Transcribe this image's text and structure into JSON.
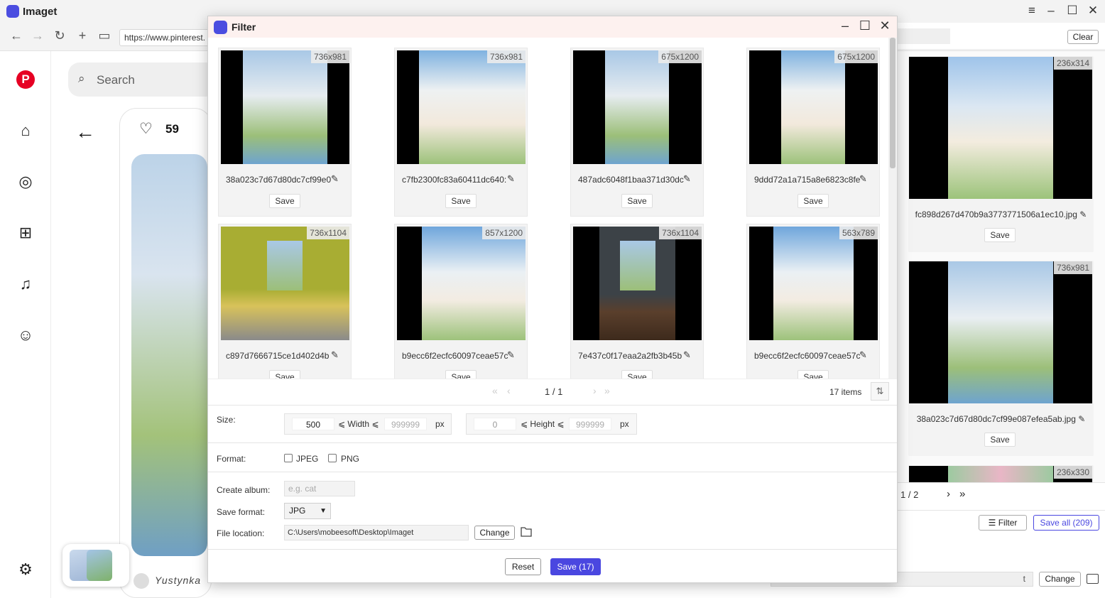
{
  "app": {
    "title": "Imaget"
  },
  "browser": {
    "url": "https://www.pinterest."
  },
  "pinterest": {
    "search_placeholder": "Search",
    "likes": "59",
    "author": "Yustynka"
  },
  "filter_dialog": {
    "title": "Filter",
    "cards": [
      {
        "dim": "736x981",
        "name": "38a023c7d67d80dc7cf99e0",
        "save": "Save"
      },
      {
        "dim": "736x981",
        "name": "c7fb2300fc83a60411dc640:",
        "save": "Save"
      },
      {
        "dim": "675x1200",
        "name": "487adc6048f1baa371d30dc",
        "save": "Save"
      },
      {
        "dim": "675x1200",
        "name": "9ddd72a1a715a8e6823c8fe",
        "save": "Save"
      },
      {
        "dim": "736x1104",
        "name": "c897d7666715ce1d402d4b",
        "save": "Save"
      },
      {
        "dim": "857x1200",
        "name": "b9ecc6f2ecfc60097ceae57c",
        "save": "Save"
      },
      {
        "dim": "736x1104",
        "name": "7e437c0f17eaa2a2fb3b45b",
        "save": "Save"
      },
      {
        "dim": "563x789",
        "name": "b9ecc6f2ecfc60097ceae57c",
        "save": "Save"
      }
    ],
    "pager": {
      "text": "1 / 1",
      "items": "17 items"
    },
    "size": {
      "label": "Size:",
      "width_min": "500",
      "width_label": "Width",
      "width_max": "999999",
      "height_min": "0",
      "height_label": "Height",
      "height_max": "999999",
      "unit": "px"
    },
    "format": {
      "label": "Format:",
      "jpeg": "JPEG",
      "png": "PNG"
    },
    "album": {
      "label": "Create album:",
      "placeholder": "e.g. cat"
    },
    "save_format": {
      "label": "Save format:",
      "value": "JPG"
    },
    "location": {
      "label": "File location:",
      "path": "C:\\Users\\mobeesoft\\Desktop\\Imaget",
      "change": "Change"
    },
    "reset": "Reset",
    "save_all": "Save (17)"
  },
  "right_panel": {
    "clear": "Clear",
    "cards": [
      {
        "dim": "236x314",
        "name": "fc898d267d470b9a3773771506a1ec10.jpg",
        "save": "Save"
      },
      {
        "dim": "736x981",
        "name": "38a023c7d67d80dc7cf99e087efea5ab.jpg",
        "save": "Save"
      },
      {
        "dim": "236x330"
      }
    ],
    "pager": "1 / 2",
    "filter": "Filter",
    "save_all": "Save all (209)",
    "change": "Change",
    "path_tail": "t"
  }
}
